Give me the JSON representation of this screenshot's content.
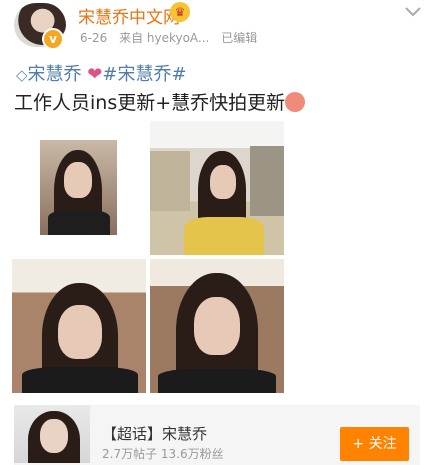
{
  "post": {
    "author": "宋慧乔中文网",
    "date": "6-26",
    "source": "来自 hyekyoA...",
    "edited": "已编辑",
    "line1": {
      "tag1": "宋慧乔",
      "tag2": "#宋慧乔#"
    },
    "line2": "工作人员ins更新+慧乔快拍更新"
  },
  "card": {
    "title": "【超话】宋慧乔",
    "subtitle": "2.7万帖子 13.6万粉丝",
    "follow_label": "+ 关注"
  },
  "icons": {
    "verified": "verified-badge-icon",
    "crown": "crown-emoji-icon",
    "menu": "chevron-down-icon",
    "gem": "diamond-icon",
    "heart": "heart-icon",
    "party": "party-emoji-icon"
  },
  "colors": {
    "username": "#e8730f",
    "link": "#507daf",
    "follow_button": "#ff8200"
  }
}
